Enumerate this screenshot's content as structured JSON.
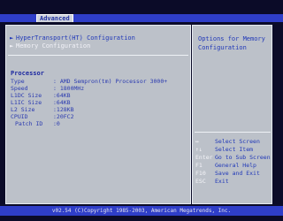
{
  "menu_bar": {
    "active_tab": "Advanced"
  },
  "main": {
    "menu_items": [
      {
        "label": "HyperTransport(HT) Configuration",
        "selected": false
      },
      {
        "label": "Memory Configuration",
        "selected": true
      }
    ],
    "section_title": "Processor",
    "processor_info": [
      {
        "label": "Type",
        "value": ": AMD Sempron(tm) Processor 3000+"
      },
      {
        "label": "Speed",
        "value": ": 1800MHz"
      },
      {
        "label": "L1DC Size",
        "value": ":64KB"
      },
      {
        "label": "L1IC Size",
        "value": ":64KB"
      },
      {
        "label": "L2 Size",
        "value": ":128KB"
      },
      {
        "label": "CPUID",
        "value": ":20FC2"
      },
      {
        "label": "Patch ID",
        "value": ":0"
      }
    ]
  },
  "help": {
    "title": "Options for Memory Configuration",
    "keys": [
      {
        "key": "↔",
        "desc": "Select Screen"
      },
      {
        "key": "↑↓",
        "desc": "Select Item"
      },
      {
        "key": "Enter",
        "desc": "Go to Sub Screen"
      },
      {
        "key": "F1",
        "desc": "General Help"
      },
      {
        "key": "F10",
        "desc": "Save and Exit"
      },
      {
        "key": "ESC",
        "desc": "Exit"
      }
    ]
  },
  "footer": {
    "copyright": "v02.54 (C)Copyright 1985-2003, American Megatrends, Inc."
  },
  "colors": {
    "menu_bar": "#2f3ec8",
    "panel": "#bcc1c9",
    "accent_text": "#2038b8",
    "highlight_text": "#f2f2f8"
  }
}
